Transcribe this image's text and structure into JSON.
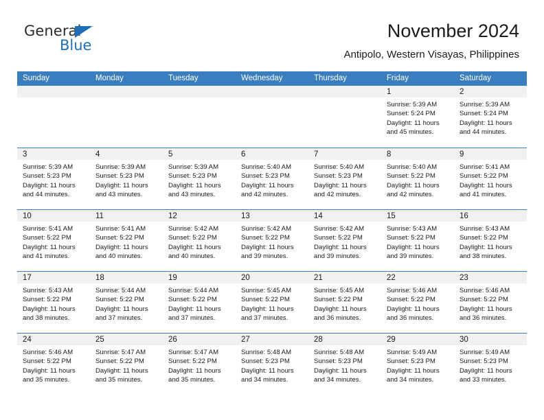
{
  "logo": {
    "word_one": "General",
    "word_two": "Blue",
    "mark": "triangle-icon",
    "accent_color": "#1f6fb5"
  },
  "header": {
    "title": "November 2024",
    "subtitle": "Antipolo, Western Visayas, Philippines"
  },
  "colors": {
    "header_blue": "#3a7ebf",
    "day_band_gray": "#f1f1f1",
    "text": "#1a1a1a",
    "white": "#ffffff"
  },
  "weekdays": [
    "Sunday",
    "Monday",
    "Tuesday",
    "Wednesday",
    "Thursday",
    "Friday",
    "Saturday"
  ],
  "weeks": [
    [
      {
        "day": "",
        "empty": true
      },
      {
        "day": "",
        "empty": true
      },
      {
        "day": "",
        "empty": true
      },
      {
        "day": "",
        "empty": true
      },
      {
        "day": "",
        "empty": true
      },
      {
        "day": "1",
        "sunrise": "Sunrise: 5:39 AM",
        "sunset": "Sunset: 5:24 PM",
        "daylight_line1": "Daylight: 11 hours",
        "daylight_line2": "and 45 minutes."
      },
      {
        "day": "2",
        "sunrise": "Sunrise: 5:39 AM",
        "sunset": "Sunset: 5:24 PM",
        "daylight_line1": "Daylight: 11 hours",
        "daylight_line2": "and 44 minutes."
      }
    ],
    [
      {
        "day": "3",
        "sunrise": "Sunrise: 5:39 AM",
        "sunset": "Sunset: 5:23 PM",
        "daylight_line1": "Daylight: 11 hours",
        "daylight_line2": "and 44 minutes."
      },
      {
        "day": "4",
        "sunrise": "Sunrise: 5:39 AM",
        "sunset": "Sunset: 5:23 PM",
        "daylight_line1": "Daylight: 11 hours",
        "daylight_line2": "and 43 minutes."
      },
      {
        "day": "5",
        "sunrise": "Sunrise: 5:39 AM",
        "sunset": "Sunset: 5:23 PM",
        "daylight_line1": "Daylight: 11 hours",
        "daylight_line2": "and 43 minutes."
      },
      {
        "day": "6",
        "sunrise": "Sunrise: 5:40 AM",
        "sunset": "Sunset: 5:23 PM",
        "daylight_line1": "Daylight: 11 hours",
        "daylight_line2": "and 42 minutes."
      },
      {
        "day": "7",
        "sunrise": "Sunrise: 5:40 AM",
        "sunset": "Sunset: 5:23 PM",
        "daylight_line1": "Daylight: 11 hours",
        "daylight_line2": "and 42 minutes."
      },
      {
        "day": "8",
        "sunrise": "Sunrise: 5:40 AM",
        "sunset": "Sunset: 5:22 PM",
        "daylight_line1": "Daylight: 11 hours",
        "daylight_line2": "and 42 minutes."
      },
      {
        "day": "9",
        "sunrise": "Sunrise: 5:41 AM",
        "sunset": "Sunset: 5:22 PM",
        "daylight_line1": "Daylight: 11 hours",
        "daylight_line2": "and 41 minutes."
      }
    ],
    [
      {
        "day": "10",
        "sunrise": "Sunrise: 5:41 AM",
        "sunset": "Sunset: 5:22 PM",
        "daylight_line1": "Daylight: 11 hours",
        "daylight_line2": "and 41 minutes."
      },
      {
        "day": "11",
        "sunrise": "Sunrise: 5:41 AM",
        "sunset": "Sunset: 5:22 PM",
        "daylight_line1": "Daylight: 11 hours",
        "daylight_line2": "and 40 minutes."
      },
      {
        "day": "12",
        "sunrise": "Sunrise: 5:42 AM",
        "sunset": "Sunset: 5:22 PM",
        "daylight_line1": "Daylight: 11 hours",
        "daylight_line2": "and 40 minutes."
      },
      {
        "day": "13",
        "sunrise": "Sunrise: 5:42 AM",
        "sunset": "Sunset: 5:22 PM",
        "daylight_line1": "Daylight: 11 hours",
        "daylight_line2": "and 39 minutes."
      },
      {
        "day": "14",
        "sunrise": "Sunrise: 5:42 AM",
        "sunset": "Sunset: 5:22 PM",
        "daylight_line1": "Daylight: 11 hours",
        "daylight_line2": "and 39 minutes."
      },
      {
        "day": "15",
        "sunrise": "Sunrise: 5:43 AM",
        "sunset": "Sunset: 5:22 PM",
        "daylight_line1": "Daylight: 11 hours",
        "daylight_line2": "and 39 minutes."
      },
      {
        "day": "16",
        "sunrise": "Sunrise: 5:43 AM",
        "sunset": "Sunset: 5:22 PM",
        "daylight_line1": "Daylight: 11 hours",
        "daylight_line2": "and 38 minutes."
      }
    ],
    [
      {
        "day": "17",
        "sunrise": "Sunrise: 5:43 AM",
        "sunset": "Sunset: 5:22 PM",
        "daylight_line1": "Daylight: 11 hours",
        "daylight_line2": "and 38 minutes."
      },
      {
        "day": "18",
        "sunrise": "Sunrise: 5:44 AM",
        "sunset": "Sunset: 5:22 PM",
        "daylight_line1": "Daylight: 11 hours",
        "daylight_line2": "and 37 minutes."
      },
      {
        "day": "19",
        "sunrise": "Sunrise: 5:44 AM",
        "sunset": "Sunset: 5:22 PM",
        "daylight_line1": "Daylight: 11 hours",
        "daylight_line2": "and 37 minutes."
      },
      {
        "day": "20",
        "sunrise": "Sunrise: 5:45 AM",
        "sunset": "Sunset: 5:22 PM",
        "daylight_line1": "Daylight: 11 hours",
        "daylight_line2": "and 37 minutes."
      },
      {
        "day": "21",
        "sunrise": "Sunrise: 5:45 AM",
        "sunset": "Sunset: 5:22 PM",
        "daylight_line1": "Daylight: 11 hours",
        "daylight_line2": "and 36 minutes."
      },
      {
        "day": "22",
        "sunrise": "Sunrise: 5:46 AM",
        "sunset": "Sunset: 5:22 PM",
        "daylight_line1": "Daylight: 11 hours",
        "daylight_line2": "and 36 minutes."
      },
      {
        "day": "23",
        "sunrise": "Sunrise: 5:46 AM",
        "sunset": "Sunset: 5:22 PM",
        "daylight_line1": "Daylight: 11 hours",
        "daylight_line2": "and 36 minutes."
      }
    ],
    [
      {
        "day": "24",
        "sunrise": "Sunrise: 5:46 AM",
        "sunset": "Sunset: 5:22 PM",
        "daylight_line1": "Daylight: 11 hours",
        "daylight_line2": "and 35 minutes."
      },
      {
        "day": "25",
        "sunrise": "Sunrise: 5:47 AM",
        "sunset": "Sunset: 5:22 PM",
        "daylight_line1": "Daylight: 11 hours",
        "daylight_line2": "and 35 minutes."
      },
      {
        "day": "26",
        "sunrise": "Sunrise: 5:47 AM",
        "sunset": "Sunset: 5:22 PM",
        "daylight_line1": "Daylight: 11 hours",
        "daylight_line2": "and 35 minutes."
      },
      {
        "day": "27",
        "sunrise": "Sunrise: 5:48 AM",
        "sunset": "Sunset: 5:23 PM",
        "daylight_line1": "Daylight: 11 hours",
        "daylight_line2": "and 34 minutes."
      },
      {
        "day": "28",
        "sunrise": "Sunrise: 5:48 AM",
        "sunset": "Sunset: 5:23 PM",
        "daylight_line1": "Daylight: 11 hours",
        "daylight_line2": "and 34 minutes."
      },
      {
        "day": "29",
        "sunrise": "Sunrise: 5:49 AM",
        "sunset": "Sunset: 5:23 PM",
        "daylight_line1": "Daylight: 11 hours",
        "daylight_line2": "and 34 minutes."
      },
      {
        "day": "30",
        "sunrise": "Sunrise: 5:49 AM",
        "sunset": "Sunset: 5:23 PM",
        "daylight_line1": "Daylight: 11 hours",
        "daylight_line2": "and 33 minutes."
      }
    ]
  ]
}
